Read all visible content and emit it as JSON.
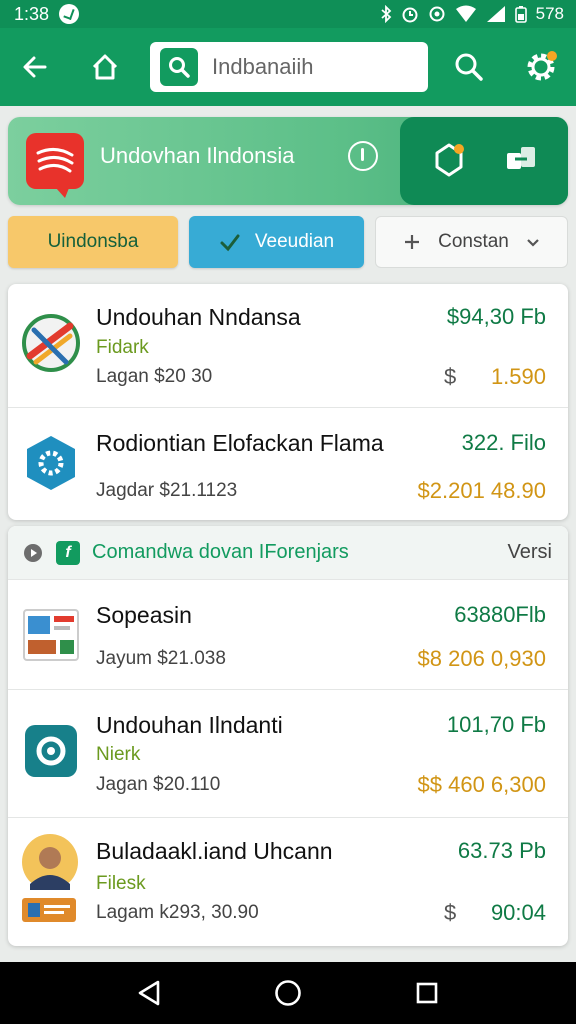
{
  "status_bar": {
    "time": "1:38",
    "battery": "578"
  },
  "app_bar": {
    "search_value": "Indbanaiih"
  },
  "banner": {
    "title": "Undovhan Ilndonsia"
  },
  "filters": [
    {
      "label": "Uindonsba"
    },
    {
      "label": "Veeudian"
    },
    {
      "label": "Constan"
    }
  ],
  "list_top": [
    {
      "name": "Undouhan Nndansa",
      "subtitle": "Fidark",
      "meta": "Lagan $20 30",
      "price": "$94,30 Fb",
      "symbol": "$",
      "amount": "1.590",
      "amount_color": "#d19515"
    },
    {
      "name": "Rodiontian Elofackan Flama",
      "meta": "Jagdar $21.1123",
      "price": "322. Filo",
      "amount": "$2.201 48.90",
      "amount_color": "#d19515"
    }
  ],
  "section": {
    "title": "Comandwa dovan IForenjars",
    "right_label": "Versi"
  },
  "list_bottom": [
    {
      "name": "Sopeasin",
      "meta": "Jayum $21.038",
      "price": "63880Flb",
      "amount": "$8 206 0,930"
    },
    {
      "name": "Undouhan Ilndanti",
      "subtitle": "Nierk",
      "meta": "Jagan $20.110",
      "price": "101,70 Fb",
      "amount": "$$ 460 6,300"
    },
    {
      "name": "Buladaakl.iand Uhcann",
      "subtitle": "Filesk",
      "meta": "Lagam k293, 30.90",
      "price": "63.73 Pb",
      "symbol": "$",
      "amount": "90:04"
    }
  ],
  "colors": {
    "primary": "#129b5f",
    "primary_dark": "#0f8a55",
    "accent_yellow": "#f7c86a",
    "accent_blue": "#37abd5",
    "amount_orange": "#d19515",
    "price_green": "#0f7a45"
  },
  "icons": {
    "back": "arrow-left-icon",
    "home": "home-icon",
    "search": "search-icon",
    "settings": "gear-icon",
    "info": "info-icon",
    "hub": "hub-icon",
    "share": "share-icon",
    "check": "check-icon",
    "plus": "plus-icon",
    "dropdown": "chevron-down-icon"
  }
}
